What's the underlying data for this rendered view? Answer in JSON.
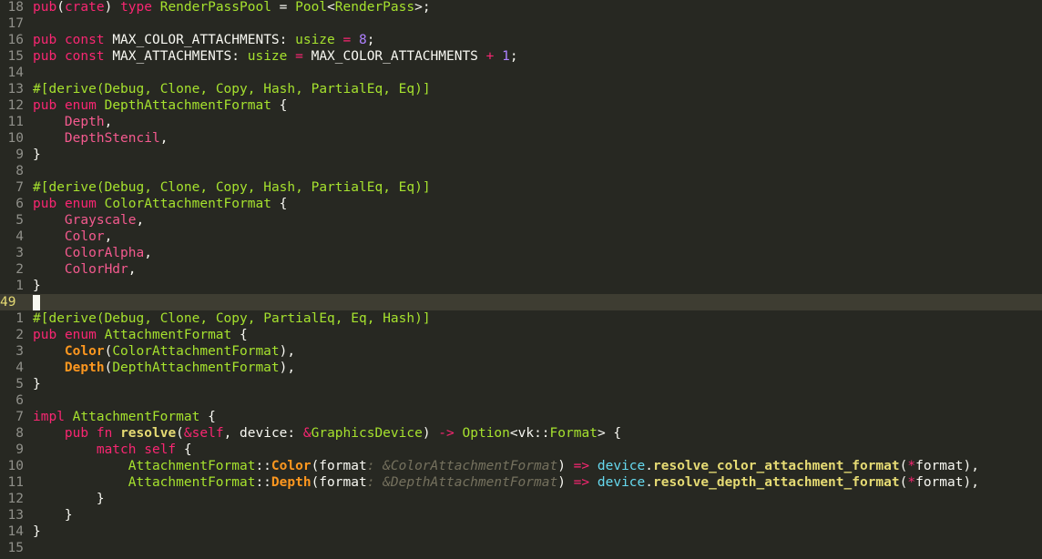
{
  "editor": {
    "current_line_number": "49",
    "lines": [
      {
        "n": "18",
        "segments": [
          [
            "kw",
            "pub"
          ],
          [
            "pl",
            "("
          ],
          [
            "kw",
            "crate"
          ],
          [
            "pl",
            ") "
          ],
          [
            "kw",
            "type"
          ],
          [
            "pl",
            " "
          ],
          [
            "ty",
            "RenderPassPool"
          ],
          [
            "pl",
            " = "
          ],
          [
            "ty",
            "Pool"
          ],
          [
            "pl",
            "<"
          ],
          [
            "ty",
            "RenderPass"
          ],
          [
            "pl",
            ">;"
          ]
        ]
      },
      {
        "n": "17",
        "segments": []
      },
      {
        "n": "16",
        "segments": [
          [
            "kw",
            "pub"
          ],
          [
            "pl",
            " "
          ],
          [
            "kw",
            "const"
          ],
          [
            "pl",
            " MAX_COLOR_ATTACHMENTS: "
          ],
          [
            "ty",
            "usize"
          ],
          [
            "pl",
            " "
          ],
          [
            "op",
            "="
          ],
          [
            "pl",
            " "
          ],
          [
            "nm",
            "8"
          ],
          [
            "pl",
            ";"
          ]
        ]
      },
      {
        "n": "15",
        "segments": [
          [
            "kw",
            "pub"
          ],
          [
            "pl",
            " "
          ],
          [
            "kw",
            "const"
          ],
          [
            "pl",
            " MAX_ATTACHMENTS: "
          ],
          [
            "ty",
            "usize"
          ],
          [
            "pl",
            " "
          ],
          [
            "op",
            "="
          ],
          [
            "pl",
            " MAX_COLOR_ATTACHMENTS "
          ],
          [
            "op",
            "+"
          ],
          [
            "pl",
            " "
          ],
          [
            "nm",
            "1"
          ],
          [
            "pl",
            ";"
          ]
        ]
      },
      {
        "n": "14",
        "segments": []
      },
      {
        "n": "13",
        "segments": [
          [
            "at",
            "#[derive("
          ],
          [
            "ty",
            "Debug"
          ],
          [
            "at",
            ", "
          ],
          [
            "ty",
            "Clone"
          ],
          [
            "at",
            ", "
          ],
          [
            "ty",
            "Copy"
          ],
          [
            "at",
            ", "
          ],
          [
            "ty",
            "Hash"
          ],
          [
            "at",
            ", "
          ],
          [
            "ty",
            "PartialEq"
          ],
          [
            "at",
            ", "
          ],
          [
            "ty",
            "Eq"
          ],
          [
            "at",
            ")]"
          ]
        ]
      },
      {
        "n": "12",
        "segments": [
          [
            "kw",
            "pub"
          ],
          [
            "pl",
            " "
          ],
          [
            "kw",
            "enum"
          ],
          [
            "pl",
            " "
          ],
          [
            "ty",
            "DepthAttachmentFormat"
          ],
          [
            "pl",
            " {"
          ]
        ]
      },
      {
        "n": "11",
        "segments": [
          [
            "pl",
            "    "
          ],
          [
            "vn",
            "Depth"
          ],
          [
            "pl",
            ","
          ]
        ]
      },
      {
        "n": "10",
        "segments": [
          [
            "pl",
            "    "
          ],
          [
            "vn",
            "DepthStencil"
          ],
          [
            "pl",
            ","
          ]
        ]
      },
      {
        "n": "9",
        "segments": [
          [
            "pl",
            "}"
          ]
        ]
      },
      {
        "n": "8",
        "segments": []
      },
      {
        "n": "7",
        "segments": [
          [
            "at",
            "#[derive("
          ],
          [
            "ty",
            "Debug"
          ],
          [
            "at",
            ", "
          ],
          [
            "ty",
            "Clone"
          ],
          [
            "at",
            ", "
          ],
          [
            "ty",
            "Copy"
          ],
          [
            "at",
            ", "
          ],
          [
            "ty",
            "Hash"
          ],
          [
            "at",
            ", "
          ],
          [
            "ty",
            "PartialEq"
          ],
          [
            "at",
            ", "
          ],
          [
            "ty",
            "Eq"
          ],
          [
            "at",
            ")]"
          ]
        ]
      },
      {
        "n": "6",
        "segments": [
          [
            "kw",
            "pub"
          ],
          [
            "pl",
            " "
          ],
          [
            "kw",
            "enum"
          ],
          [
            "pl",
            " "
          ],
          [
            "ty",
            "ColorAttachmentFormat"
          ],
          [
            "pl",
            " {"
          ]
        ]
      },
      {
        "n": "5",
        "segments": [
          [
            "pl",
            "    "
          ],
          [
            "vn",
            "Grayscale"
          ],
          [
            "pl",
            ","
          ]
        ]
      },
      {
        "n": "4",
        "segments": [
          [
            "pl",
            "    "
          ],
          [
            "vn",
            "Color"
          ],
          [
            "pl",
            ","
          ]
        ]
      },
      {
        "n": "3",
        "segments": [
          [
            "pl",
            "    "
          ],
          [
            "vn",
            "ColorAlpha"
          ],
          [
            "pl",
            ","
          ]
        ]
      },
      {
        "n": "2",
        "segments": [
          [
            "pl",
            "    "
          ],
          [
            "vn",
            "ColorHdr"
          ],
          [
            "pl",
            ","
          ]
        ]
      },
      {
        "n": "1",
        "segments": [
          [
            "pl",
            "}"
          ]
        ]
      },
      {
        "n": "49",
        "current": true,
        "segments": []
      },
      {
        "n": "1",
        "segments": [
          [
            "at",
            "#[derive("
          ],
          [
            "ty",
            "Debug"
          ],
          [
            "at",
            ", "
          ],
          [
            "ty",
            "Clone"
          ],
          [
            "at",
            ", "
          ],
          [
            "ty",
            "Copy"
          ],
          [
            "at",
            ", "
          ],
          [
            "ty",
            "PartialEq"
          ],
          [
            "at",
            ", "
          ],
          [
            "ty",
            "Eq"
          ],
          [
            "at",
            ", "
          ],
          [
            "ty",
            "Hash"
          ],
          [
            "at",
            ")]"
          ]
        ]
      },
      {
        "n": "2",
        "segments": [
          [
            "kw",
            "pub"
          ],
          [
            "pl",
            " "
          ],
          [
            "kw",
            "enum"
          ],
          [
            "pl",
            " "
          ],
          [
            "ty",
            "AttachmentFormat"
          ],
          [
            "pl",
            " {"
          ]
        ]
      },
      {
        "n": "3",
        "segments": [
          [
            "pl",
            "    "
          ],
          [
            "vr",
            "Color"
          ],
          [
            "pl",
            "("
          ],
          [
            "ty",
            "ColorAttachmentFormat"
          ],
          [
            "pl",
            "),"
          ]
        ]
      },
      {
        "n": "4",
        "segments": [
          [
            "pl",
            "    "
          ],
          [
            "vr",
            "Depth"
          ],
          [
            "pl",
            "("
          ],
          [
            "ty",
            "DepthAttachmentFormat"
          ],
          [
            "pl",
            "),"
          ]
        ]
      },
      {
        "n": "5",
        "segments": [
          [
            "pl",
            "}"
          ]
        ]
      },
      {
        "n": "6",
        "segments": []
      },
      {
        "n": "7",
        "segments": [
          [
            "kw",
            "impl"
          ],
          [
            "pl",
            " "
          ],
          [
            "ty",
            "AttachmentFormat"
          ],
          [
            "pl",
            " {"
          ]
        ]
      },
      {
        "n": "8",
        "segments": [
          [
            "pl",
            "    "
          ],
          [
            "kw",
            "pub"
          ],
          [
            "pl",
            " "
          ],
          [
            "kw",
            "fn"
          ],
          [
            "pl",
            " "
          ],
          [
            "fn",
            "resolve"
          ],
          [
            "pl",
            "("
          ],
          [
            "op",
            "&"
          ],
          [
            "kw",
            "self"
          ],
          [
            "pl",
            ", device: "
          ],
          [
            "op",
            "&"
          ],
          [
            "ty",
            "GraphicsDevice"
          ],
          [
            "pl",
            ") "
          ],
          [
            "op",
            "->"
          ],
          [
            "pl",
            " "
          ],
          [
            "ty",
            "Option"
          ],
          [
            "pl",
            "<vk::"
          ],
          [
            "ty",
            "Format"
          ],
          [
            "pl",
            "> {"
          ]
        ]
      },
      {
        "n": "9",
        "segments": [
          [
            "pl",
            "        "
          ],
          [
            "kw",
            "match"
          ],
          [
            "pl",
            " "
          ],
          [
            "kw",
            "self"
          ],
          [
            "pl",
            " {"
          ]
        ]
      },
      {
        "n": "10",
        "segments": [
          [
            "pl",
            "            "
          ],
          [
            "ty",
            "AttachmentFormat"
          ],
          [
            "pl",
            "::"
          ],
          [
            "vr",
            "Color"
          ],
          [
            "pl",
            "(format"
          ],
          [
            "hint",
            ": &ColorAttachmentFormat"
          ],
          [
            "pl",
            ") "
          ],
          [
            "op",
            "=>"
          ],
          [
            "pl",
            " "
          ],
          [
            "dv",
            "device"
          ],
          [
            "pl",
            "."
          ],
          [
            "fn",
            "resolve_color_attachment_format"
          ],
          [
            "pl",
            "("
          ],
          [
            "op",
            "*"
          ],
          [
            "pl",
            "format),"
          ]
        ]
      },
      {
        "n": "11",
        "segments": [
          [
            "pl",
            "            "
          ],
          [
            "ty",
            "AttachmentFormat"
          ],
          [
            "pl",
            "::"
          ],
          [
            "vr",
            "Depth"
          ],
          [
            "pl",
            "(format"
          ],
          [
            "hint",
            ": &DepthAttachmentFormat"
          ],
          [
            "pl",
            ") "
          ],
          [
            "op",
            "=>"
          ],
          [
            "pl",
            " "
          ],
          [
            "dv",
            "device"
          ],
          [
            "pl",
            "."
          ],
          [
            "fn",
            "resolve_depth_attachment_format"
          ],
          [
            "pl",
            "("
          ],
          [
            "op",
            "*"
          ],
          [
            "pl",
            "format),"
          ]
        ]
      },
      {
        "n": "12",
        "segments": [
          [
            "pl",
            "        }"
          ]
        ]
      },
      {
        "n": "13",
        "segments": [
          [
            "pl",
            "    }"
          ]
        ]
      },
      {
        "n": "14",
        "segments": [
          [
            "pl",
            "}"
          ]
        ]
      },
      {
        "n": "15",
        "segments": []
      }
    ]
  },
  "colors": {
    "background": "#272822",
    "current_line": "#3e3d32",
    "line_number": "#90908a",
    "current_line_number": "#e6db74"
  }
}
